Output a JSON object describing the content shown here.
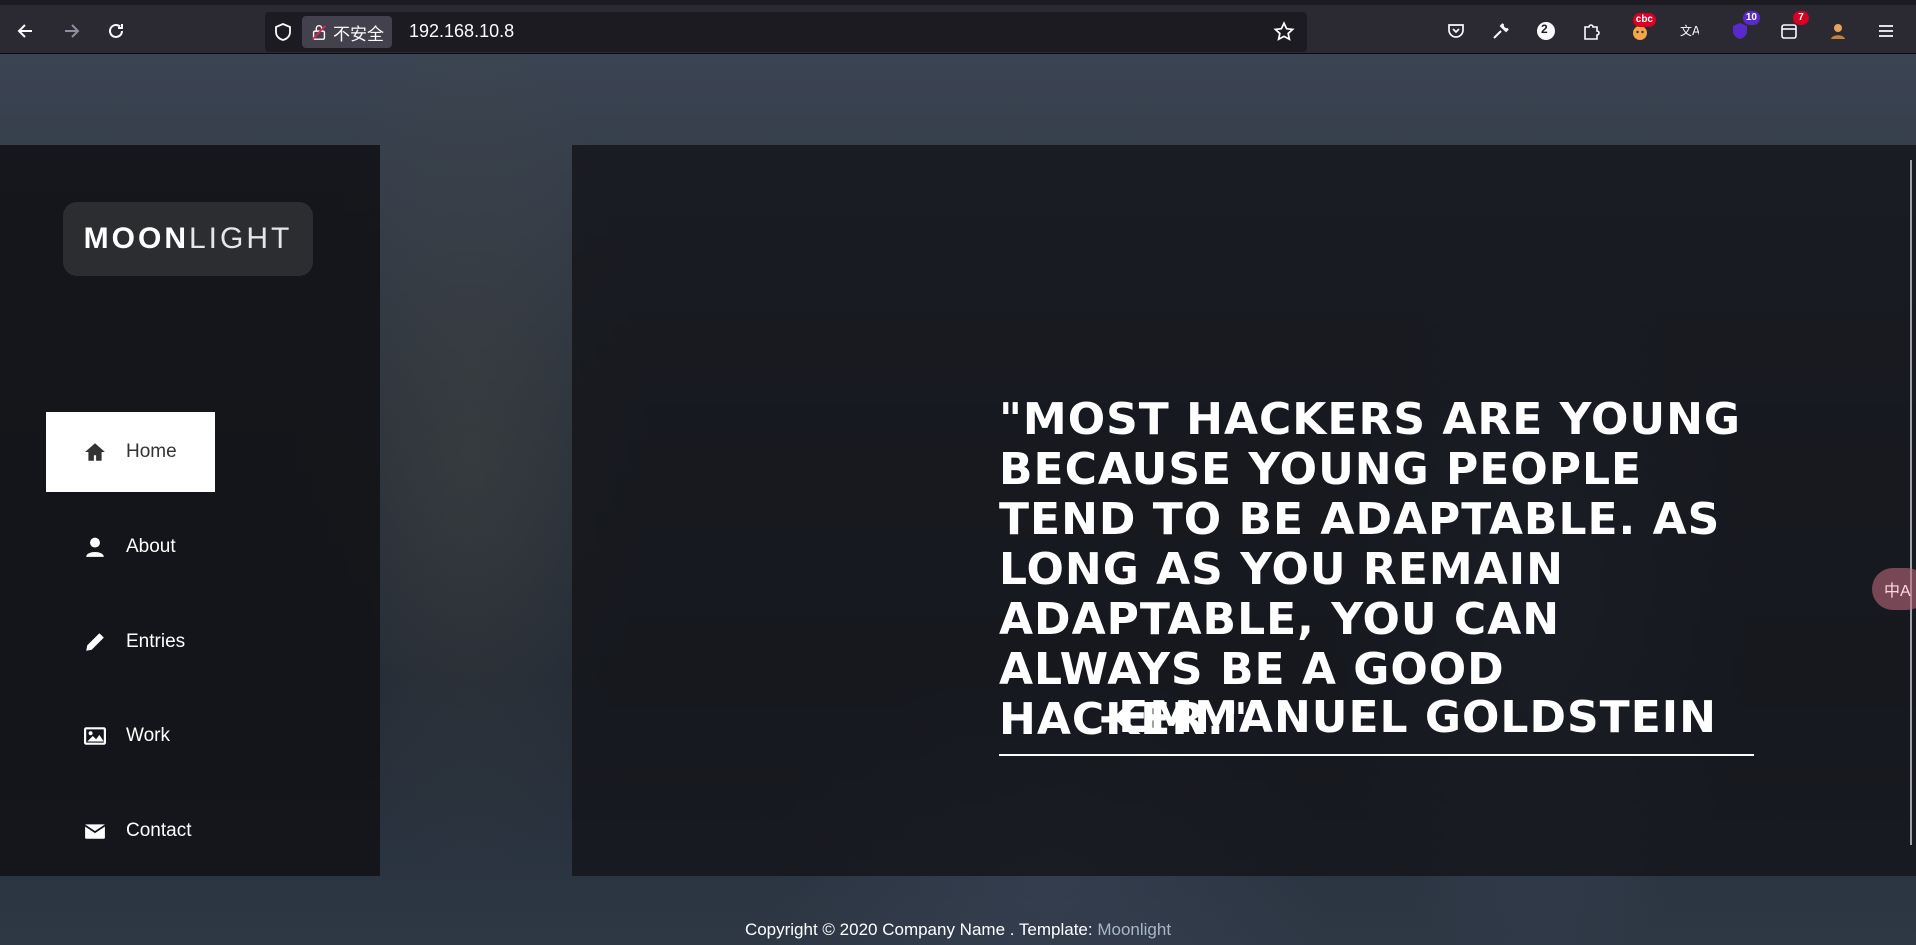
{
  "browser": {
    "security_label": "不安全",
    "url": "192.168.10.8",
    "badges": {
      "pocket_count": "2",
      "ext_1": "10",
      "ext_2": "7",
      "ext_cbc": "cbc"
    }
  },
  "sidebar": {
    "logo_bold": "MOON",
    "logo_light": "LIGHT",
    "nav": [
      {
        "label": "Home",
        "icon": "home-icon",
        "active": true
      },
      {
        "label": "About",
        "icon": "user-icon",
        "active": false
      },
      {
        "label": "Entries",
        "icon": "pencil-icon",
        "active": false
      },
      {
        "label": "Work",
        "icon": "image-icon",
        "active": false
      },
      {
        "label": "Contact",
        "icon": "envelope-icon",
        "active": false
      }
    ]
  },
  "hero": {
    "quote": "\"MOST HACKERS ARE YOUNG BECAUSE YOUNG PEOPLE TEND TO BE ADAPTABLE. AS LONG AS YOU REMAIN ADAPTABLE, YOU CAN ALWAYS BE A GOOD HACKER.\"",
    "author": "-EMMANUEL GOLDSTEIN"
  },
  "footer": {
    "text": "Copyright © 2020 Company Name . Template: ",
    "link": "Moonlight"
  },
  "translate_widget": "中A",
  "colors": {
    "toolbar": "#2b2a33",
    "urlbar": "#1c1b22",
    "sidebar_bg": "#121318",
    "active_nav_bg": "#ffffff",
    "footer_link": "#a7b7c8"
  }
}
